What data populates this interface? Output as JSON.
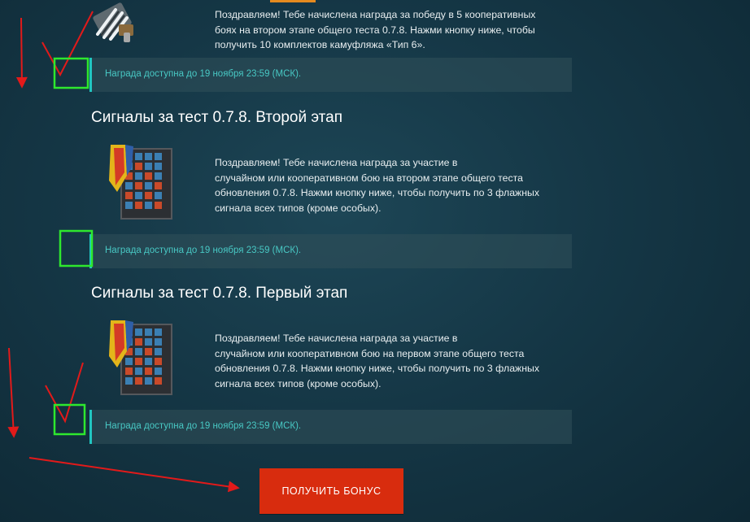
{
  "rewards": [
    {
      "title": "",
      "description": "Поздравляем! Тебе начислена награда за победу в 5 кооперативных боях на втором этапе общего теста 0.7.8. Нажми кнопку ниже, чтобы получить 10 комплектов камуфляжа «Тип 6».",
      "lines": [
        "Поздравляем! Тебе начислена награда за победу в 5 кооперативных",
        "боях на втором этапе общего теста 0.7.8. Нажми кнопку ниже, чтобы",
        "получить 10 комплектов камуфляжа «Тип 6»."
      ],
      "status": "Награда доступна до 19 ноября 23:59 (МСК).",
      "icon": "camouflage-paint-icon"
    },
    {
      "title": "Сигналы за тест 0.7.8. Второй этап",
      "lines": [
        "Поздравляем! Тебе начислена награда за участие в",
        "случайном или кооперативном бою на втором этапе общего теста",
        "обновления 0.7.8. Нажми кнопку ниже, чтобы получить по 3 флажных",
        "сигнала всех типов (кроме особых)."
      ],
      "status": "Награда доступна до 19 ноября 23:59 (МСК).",
      "icon": "signal-flags-cabinet-icon"
    },
    {
      "title": "Сигналы за тест 0.7.8. Первый этап",
      "lines": [
        "Поздравляем! Тебе начислена награда за участие в",
        "случайном или кооперативном бою на первом этапе общего теста",
        "обновления 0.7.8. Нажми кнопку ниже, чтобы получить по 3 флажных",
        "сигнала всех типов (кроме особых)."
      ],
      "status": "Награда доступна до 19 ноября 23:59 (МСК).",
      "icon": "signal-flags-cabinet-icon"
    }
  ],
  "claim_button": {
    "label": "ПОЛУЧИТЬ БОНУС"
  },
  "colors": {
    "accent_teal": "#21c6c1",
    "status_text": "#48c8c4",
    "button_red": "#d82c0e",
    "annotation_red": "#e21a1a",
    "annotation_green": "#2ee82e"
  }
}
